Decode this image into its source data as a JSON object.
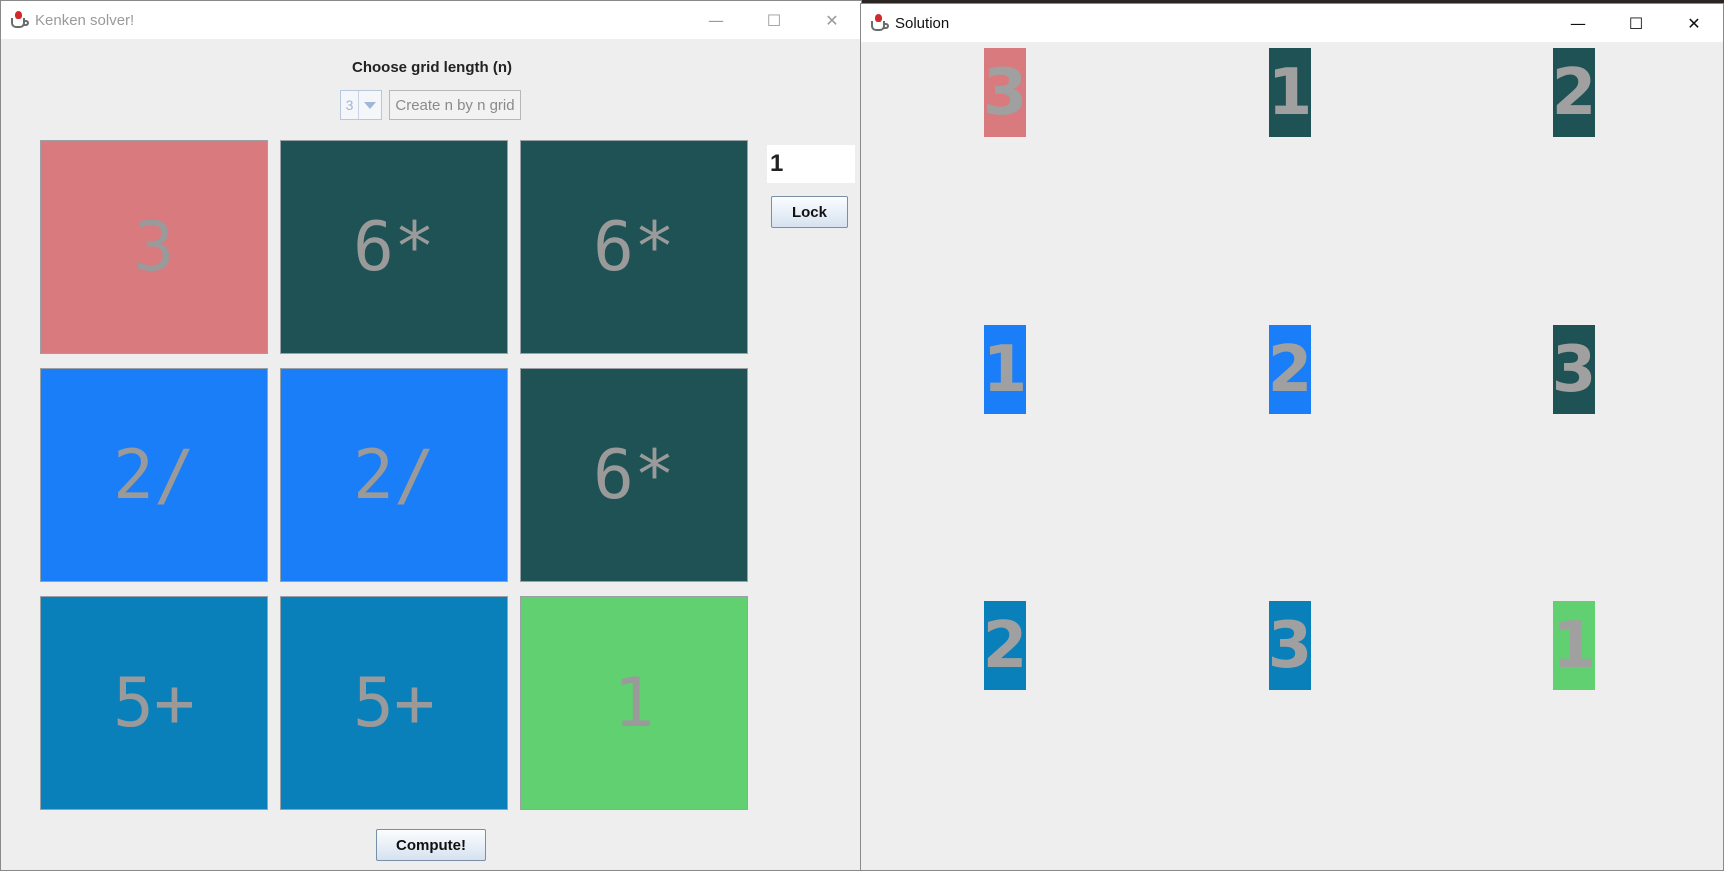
{
  "left_window": {
    "title": "Kenken solver!",
    "controls": {
      "minimize": "—",
      "maximize": "☐",
      "close": "✕"
    },
    "choose_label": "Choose grid length (n)",
    "grid_length_value": "3",
    "create_button": "Create n by n grid",
    "value_field": "1",
    "lock_button": "Lock",
    "compute_button": "Compute!",
    "grid": [
      [
        "3",
        "6*",
        "6*"
      ],
      [
        "2/",
        "2/",
        "6*"
      ],
      [
        "5+",
        "5+",
        "1"
      ]
    ],
    "grid_colors": [
      [
        "#d87a7e",
        "#1e5254",
        "#1e5254"
      ],
      [
        "#1a7ef8",
        "#1a7ef8",
        "#1e5254"
      ],
      [
        "#0a80bb",
        "#0a80bb",
        "#60d070"
      ]
    ]
  },
  "right_window": {
    "title": "Solution",
    "controls": {
      "minimize": "—",
      "maximize": "☐",
      "close": "✕"
    },
    "grid": [
      [
        "3",
        "1",
        "2"
      ],
      [
        "1",
        "2",
        "3"
      ],
      [
        "2",
        "3",
        "1"
      ]
    ]
  }
}
